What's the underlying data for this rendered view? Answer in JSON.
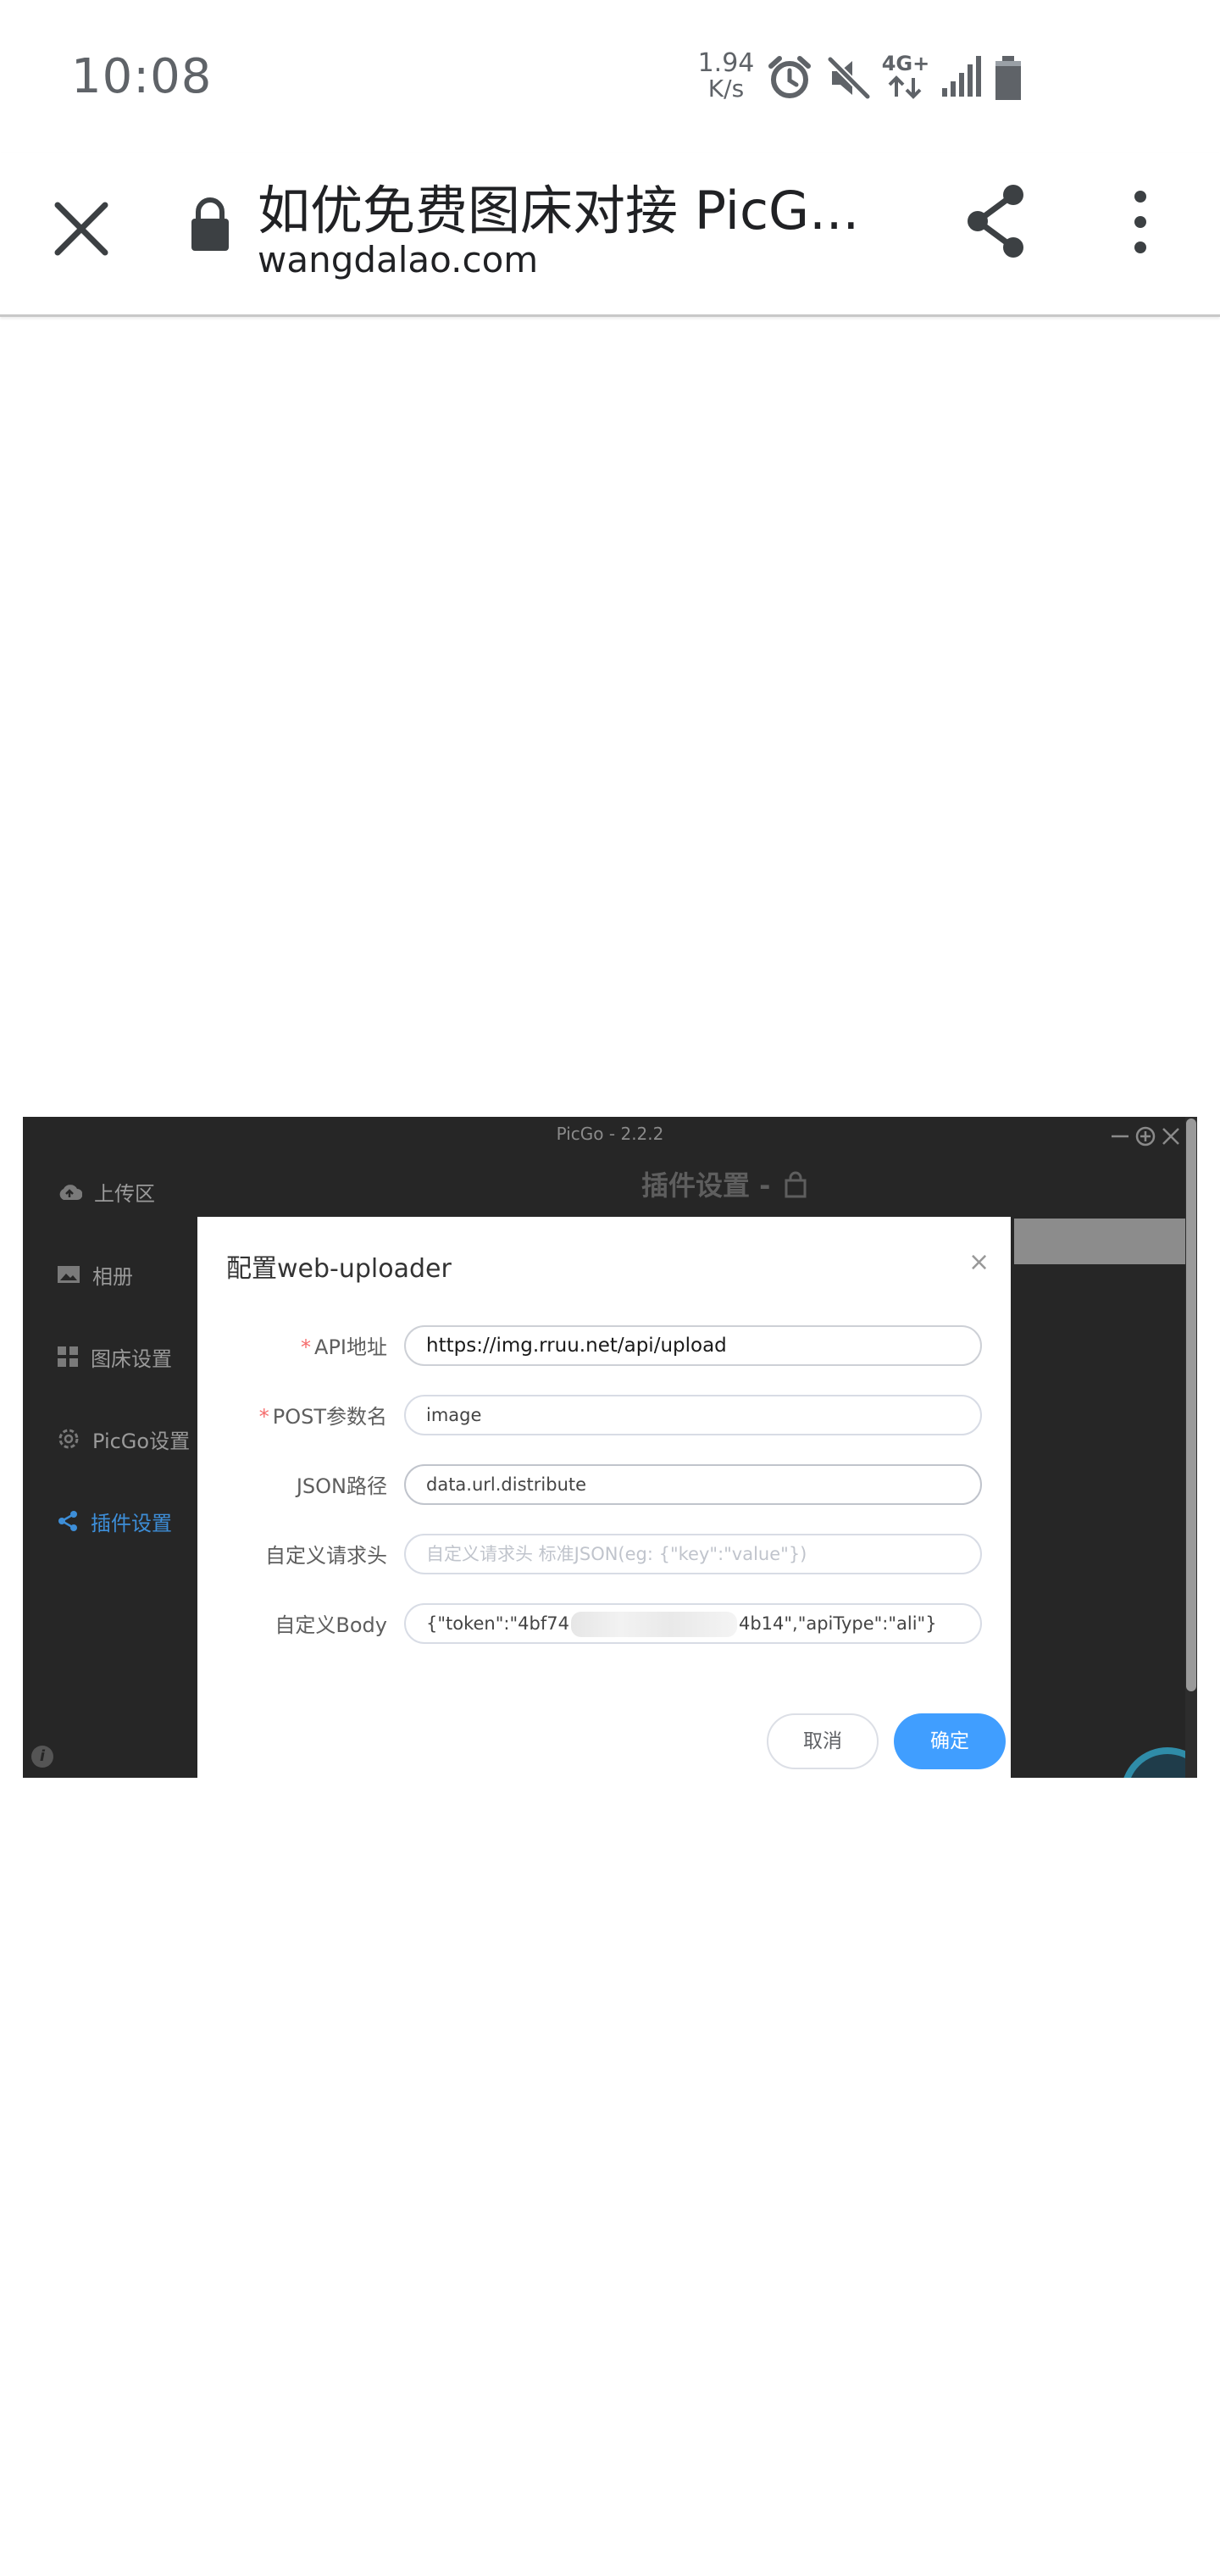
{
  "status_bar": {
    "time": "10:08",
    "net_speed_value": "1.94",
    "net_speed_unit": "K/s",
    "network_type": "4G+",
    "icons": [
      "alarm-icon",
      "mute-icon",
      "data-arrows-icon",
      "signal-icon",
      "battery-icon"
    ]
  },
  "browser": {
    "page_title": "如优免费图床对接 PicG...",
    "url": "wangdalao.com",
    "icons": [
      "close-icon",
      "lock-icon",
      "share-icon",
      "more-vert-icon"
    ]
  },
  "app": {
    "window_title": "PicGo - 2.2.2",
    "header": "插件设置 -",
    "sidebar": [
      {
        "label": "上传区",
        "icon": "cloud-upload-icon"
      },
      {
        "label": "相册",
        "icon": "image-icon"
      },
      {
        "label": "图床设置",
        "icon": "grid-icon"
      },
      {
        "label": "PicGo设置",
        "icon": "gear-icon"
      },
      {
        "label": "插件设置",
        "icon": "share-icon",
        "active": true
      }
    ],
    "colors": {
      "accent": "#409eff",
      "sidebar_active": "#3d8ed8",
      "background": "#262626"
    }
  },
  "dialog": {
    "title": "配置web-uploader",
    "fields": [
      {
        "label": "API地址",
        "required": true,
        "value": "https://img.rruu.net/api/upload"
      },
      {
        "label": "POST参数名",
        "required": true,
        "value": "image"
      },
      {
        "label": "JSON路径",
        "required": false,
        "value": "data.url.distribute"
      },
      {
        "label": "自定义请求头",
        "required": false,
        "value": "",
        "placeholder": "自定义请求头 标准JSON(eg: {\"key\":\"value\"})"
      },
      {
        "label": "自定义Body",
        "required": false,
        "value_start": "{\"token\":\"4bf74",
        "value_end": "4b14\",\"apiType\":\"ali\"}"
      }
    ],
    "cancel_label": "取消",
    "confirm_label": "确定"
  }
}
